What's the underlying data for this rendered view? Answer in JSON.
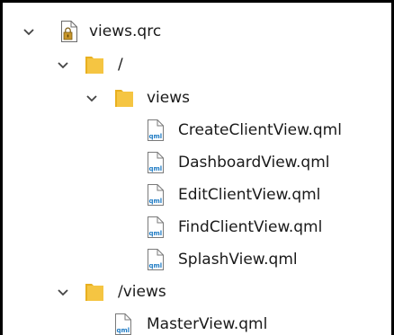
{
  "tree": {
    "root": {
      "label": "views.qrc",
      "expanded": true,
      "icon": "qrc-file-lock-icon"
    },
    "prefix_root": {
      "label": "/",
      "expanded": true,
      "icon": "folder-icon",
      "folder": {
        "label": "views",
        "expanded": true,
        "icon": "folder-icon",
        "files": [
          {
            "label": "CreateClientView.qml",
            "icon": "qml-file-icon"
          },
          {
            "label": "DashboardView.qml",
            "icon": "qml-file-icon"
          },
          {
            "label": "EditClientView.qml",
            "icon": "qml-file-icon"
          },
          {
            "label": "FindClientView.qml",
            "icon": "qml-file-icon"
          },
          {
            "label": "SplashView.qml",
            "icon": "qml-file-icon"
          }
        ]
      }
    },
    "prefix_views": {
      "label": "/views",
      "expanded": true,
      "icon": "folder-icon",
      "files": [
        {
          "label": "MasterView.qml",
          "icon": "qml-file-icon"
        }
      ]
    }
  },
  "colors": {
    "folder": "#f5c542",
    "folder_shade": "#e8b020",
    "qml_text": "#1e7bc4",
    "chevron": "#444444"
  }
}
